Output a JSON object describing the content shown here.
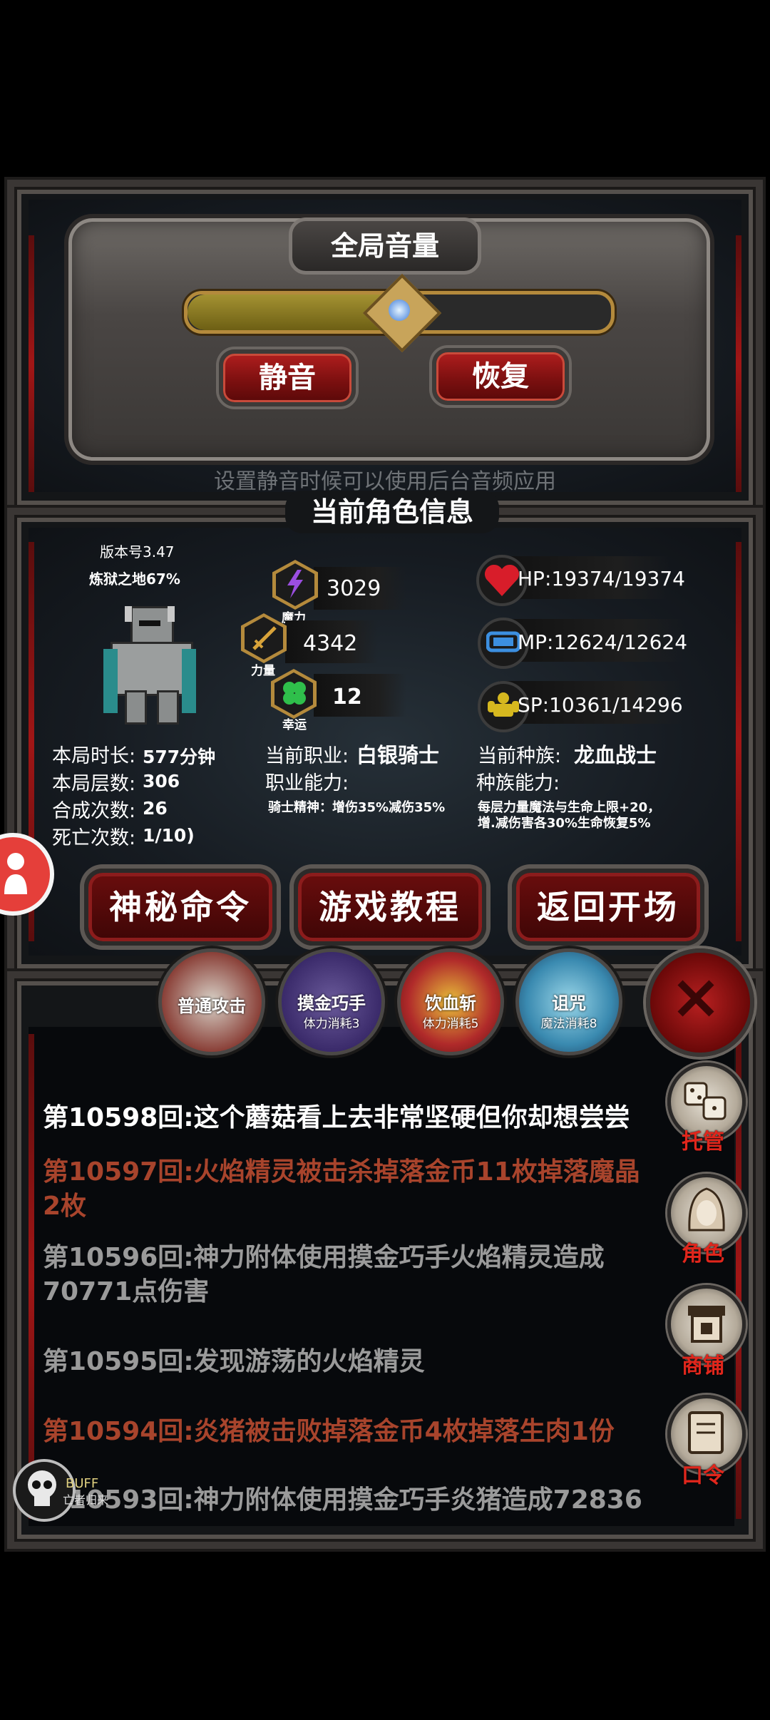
{
  "volume_panel": {
    "title": "全局音量",
    "volume_level": 0.5,
    "mute_label": "静音",
    "restore_label": "恢复",
    "hint": "设置静音时候可以使用后台音频应用"
  },
  "char_info": {
    "title": "当前角色信息",
    "version": "版本号3.47",
    "progress": "炼狱之地67%",
    "stats": [
      {
        "label": "魔力",
        "value": "3029",
        "icon": "lightning-icon"
      },
      {
        "label": "力量",
        "value": "4342",
        "icon": "sword-icon"
      },
      {
        "label": "幸运",
        "value": "12",
        "icon": "clover-icon"
      }
    ],
    "vitals": [
      {
        "text": "HP:19374/19374",
        "icon": "heart-icon"
      },
      {
        "text": "MP:12624/12624",
        "icon": "mana-icon"
      },
      {
        "text": "SP:10361/14296",
        "icon": "stamina-icon"
      }
    ],
    "run": {
      "duration_label": "本局时长:",
      "duration_value": "577分钟",
      "floors_label": "本局层数:",
      "floors_value": "306",
      "craft_label": "合成次数:",
      "craft_value": "26",
      "death_label": "死亡次数:",
      "death_value": "1/10)"
    },
    "job_label": "当前职业:",
    "job_value": "白银骑士",
    "job_ability_label": "职业能力:",
    "job_ability_text": "骑士精神：增伤35%减伤35%",
    "race_label": "当前种族:",
    "race_value": "龙血战士",
    "race_ability_label": "种族能力:",
    "race_ability_text": "每层力量魔法与生命上限+20，增.减伤害各30%生命恢复5%"
  },
  "actions": {
    "secret_cmd": "神秘命令",
    "tutorial": "游戏教程",
    "back_start": "返回开场"
  },
  "skills": [
    {
      "name": "普通攻击",
      "cost": ""
    },
    {
      "name": "摸金巧手",
      "cost": "体力消耗3"
    },
    {
      "name": "饮血斩",
      "cost": "体力消耗5"
    },
    {
      "name": "诅咒",
      "cost": "魔法消耗8"
    }
  ],
  "side_menu": {
    "auto": "托管",
    "role": "角色",
    "shop": "商铺",
    "code": "口令"
  },
  "log": [
    {
      "text": "第10598回:这个蘑菇看上去非常坚硬但你却想尝尝",
      "color": "#ffffff"
    },
    {
      "text": "第10597回:火焰精灵被击杀掉落金币11枚掉落魔晶2枚",
      "color": "#a8442c"
    },
    {
      "text": "第10596回:神力附体使用摸金巧手火焰精灵造成70771点伤害",
      "color": "#9a9a9a"
    },
    {
      "text": "第10595回:发现游荡的火焰精灵",
      "color": "#9a9a9a"
    },
    {
      "text": "第10594回:炎猪被击败掉落金币4枚掉落生肉1份",
      "color": "#a8442c"
    },
    {
      "text": "第10593回:神力附体使用摸金巧手炎猪造成72836",
      "color": "#9a9a9a"
    }
  ],
  "buff": {
    "label": "BUFF",
    "sub": "亡者归来"
  },
  "colors": {
    "accent_red": "#8c1c1c",
    "gold": "#b48a3c",
    "log_red": "#a8442c"
  }
}
